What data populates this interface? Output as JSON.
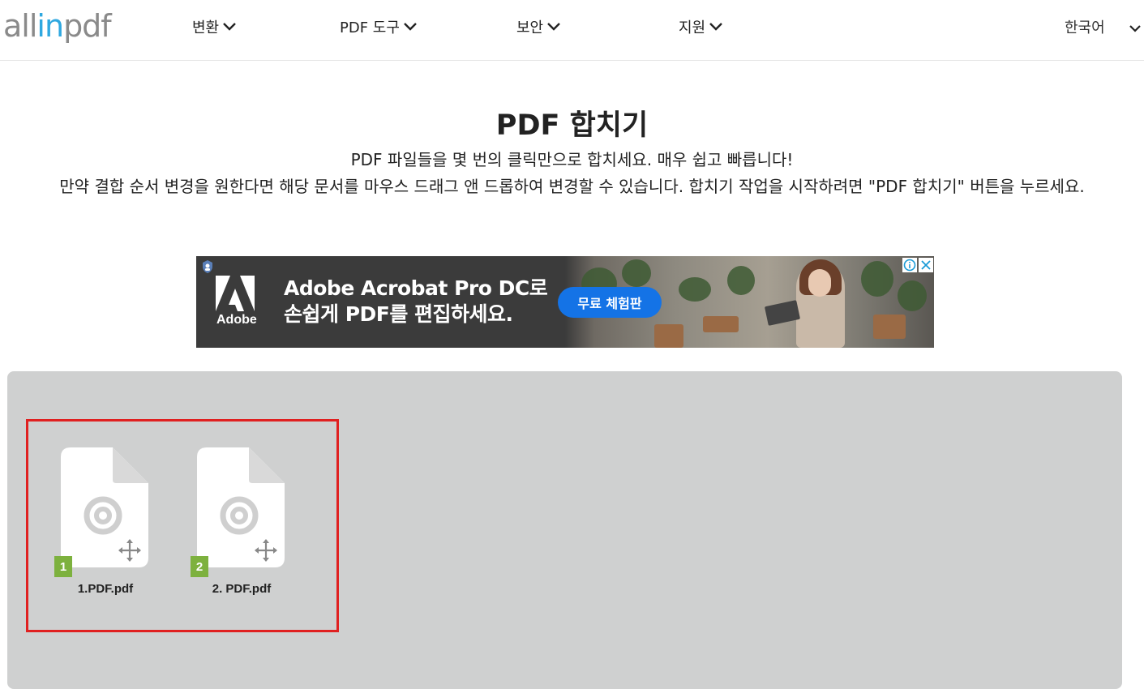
{
  "header": {
    "logo_part1": "all",
    "logo_part2": "in",
    "logo_part3": "pdf",
    "nav": [
      {
        "label": "변환",
        "icon": "chevron-down-icon"
      },
      {
        "label": "PDF 도구",
        "icon": "chevron-down-icon"
      },
      {
        "label": "보안",
        "icon": "chevron-down-icon"
      },
      {
        "label": "지원",
        "icon": "chevron-down-icon"
      }
    ],
    "language": "한국어",
    "language_icon": "chevron-down-icon"
  },
  "intro": {
    "title": "PDF 합치기",
    "line1": "PDF 파일들을 몇 번의 클릭만으로 합치세요. 매우 쉽고 빠릅니다!",
    "line2": "만약 결합 순서 변경을 원한다면 해당 문서를 마우스 드래그 앤 드롭하여 변경할 수 있습니다. 합치기 작업을 시작하려면 \"PDF 합치기\" 버튼을 누르세요."
  },
  "ad": {
    "brand": "Adobe",
    "headline_line1": "Adobe Acrobat Pro DC로",
    "headline_line2": "손쉽게 PDF를 편집하세요.",
    "cta": "무료 체험판",
    "colors": {
      "background": "#3b3b3b",
      "cta": "#1473e6"
    }
  },
  "files": [
    {
      "index": "1",
      "name": "1.PDF.pdf",
      "icon": "document-icon",
      "drag_icon": "move-icon"
    },
    {
      "index": "2",
      "name": "2. PDF.pdf",
      "icon": "document-icon",
      "drag_icon": "move-icon"
    }
  ],
  "colors": {
    "drop_area": "#cfd0d0",
    "highlight_border": "#e02020",
    "index_badge": "#7db13e",
    "logo_accent": "#2fa8e0"
  }
}
